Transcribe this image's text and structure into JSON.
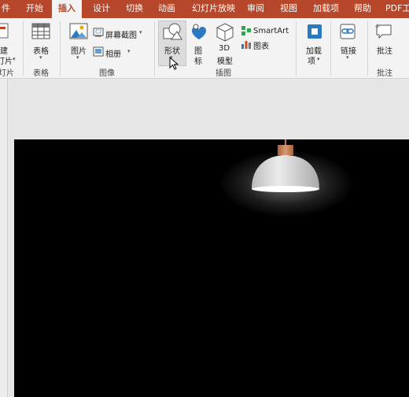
{
  "tabs": [
    {
      "label": "件"
    },
    {
      "label": "开始"
    },
    {
      "label": "插入"
    },
    {
      "label": "设计"
    },
    {
      "label": "切换"
    },
    {
      "label": "动画"
    },
    {
      "label": "幻灯片放映"
    },
    {
      "label": "审阅"
    },
    {
      "label": "视图"
    },
    {
      "label": "加载项"
    },
    {
      "label": "帮助"
    },
    {
      "label": "PDF工"
    }
  ],
  "ribbon": {
    "new_slide": {
      "line1": "建",
      "line2": "灯片"
    },
    "slides_group": "灯片",
    "table": {
      "label": "表格",
      "group": "表格"
    },
    "images": {
      "pictures": "图片",
      "screenshot": "屏幕截图",
      "album": "相册",
      "group": "图像"
    },
    "illustrations": {
      "shapes": "形状",
      "icons_line1": "图",
      "icons_line2": "标",
      "models_line1": "3D",
      "models_line2": "模型",
      "smartart": "SmartArt",
      "chart": "图表",
      "group": "插图"
    },
    "addins": {
      "line1": "加载",
      "line2": "项"
    },
    "links": {
      "label": "链接"
    },
    "comments": {
      "label": "批注",
      "group": "批注"
    }
  },
  "colors": {
    "accent": "#b7472a",
    "ribbon_bg": "#f3f3f3",
    "slide_bg": "#000000",
    "lamp_shade": "#e4e4e4",
    "lamp_cap": "#cf8860"
  }
}
